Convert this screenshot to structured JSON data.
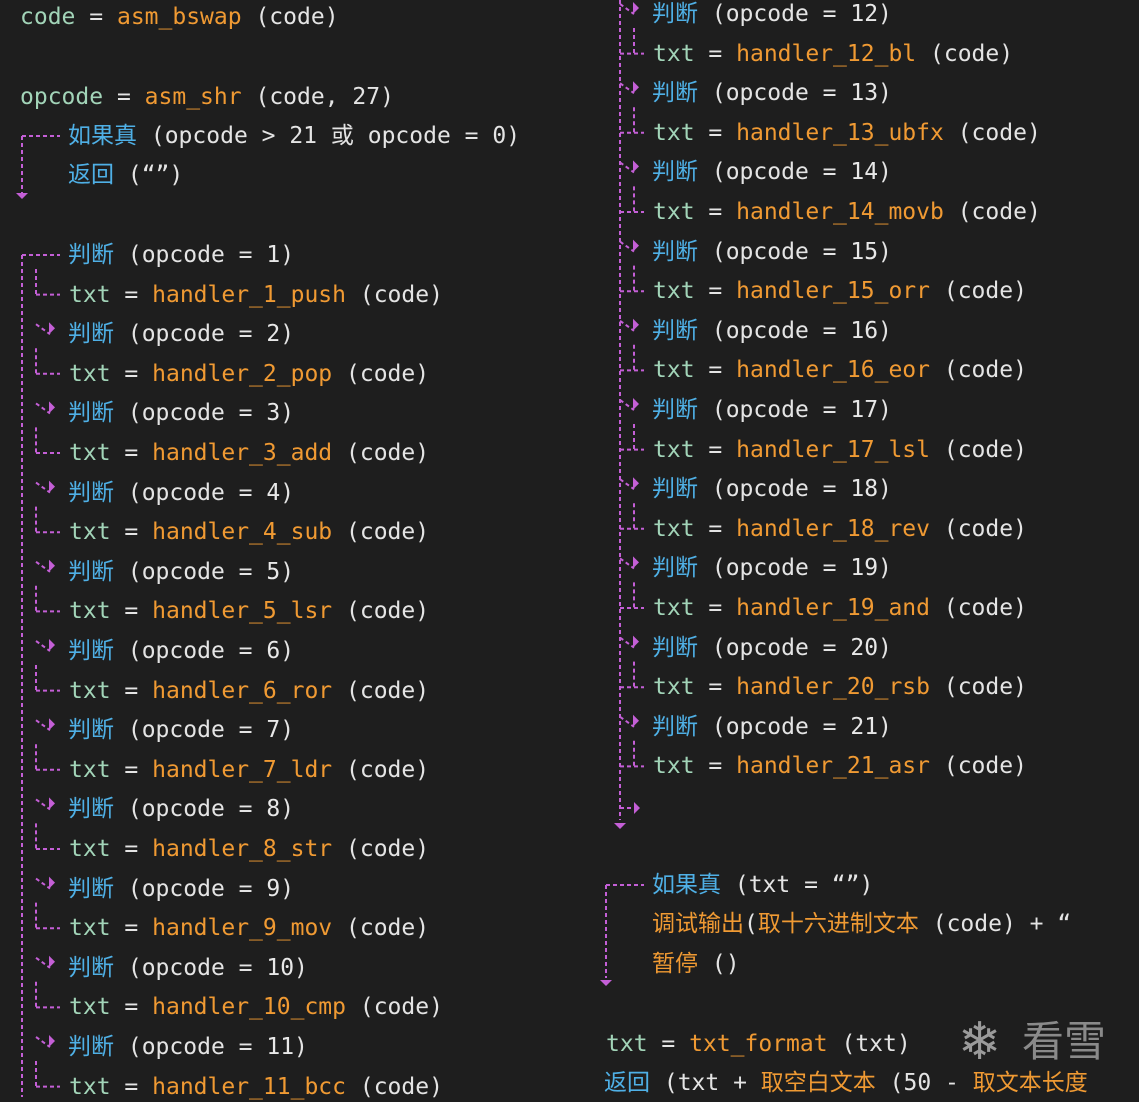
{
  "colors": {
    "background": "#1e1e1e",
    "keyword": "#4fb0e6",
    "variable": "#a2d4b8",
    "function": "#f09a33",
    "flow_line": "#c45fd6"
  },
  "code": {
    "line_code_assign": {
      "var": "code",
      "op": "=",
      "fn": "asm_bswap",
      "args": "(code)"
    },
    "line_opcode_assign": {
      "var": "opcode",
      "op": "=",
      "fn": "asm_shr",
      "args": "(code, 27)"
    },
    "if_true_1": {
      "kw": "如果真",
      "cond": "(opcode > 21 或 opcode = 0)"
    },
    "return_1": {
      "kw": "返回",
      "args": "(“”)"
    },
    "judge_kw": "判断",
    "txt_var": "txt",
    "eq": "=",
    "opcode_prefix": "(opcode = ",
    "paren_close": ")",
    "code_arg": "(code)",
    "cases": [
      {
        "n": "1",
        "handler": "handler_1_push"
      },
      {
        "n": "2",
        "handler": "handler_2_pop"
      },
      {
        "n": "3",
        "handler": "handler_3_add"
      },
      {
        "n": "4",
        "handler": "handler_4_sub"
      },
      {
        "n": "5",
        "handler": "handler_5_lsr"
      },
      {
        "n": "6",
        "handler": "handler_6_ror"
      },
      {
        "n": "7",
        "handler": "handler_7_ldr"
      },
      {
        "n": "8",
        "handler": "handler_8_str"
      },
      {
        "n": "9",
        "handler": "handler_9_mov"
      },
      {
        "n": "10",
        "handler": "handler_10_cmp"
      },
      {
        "n": "11",
        "handler": "handler_11_bcc"
      },
      {
        "n": "12",
        "handler": "handler_12_bl"
      },
      {
        "n": "13",
        "handler": "handler_13_ubfx"
      },
      {
        "n": "14",
        "handler": "handler_14_movb"
      },
      {
        "n": "15",
        "handler": "handler_15_orr"
      },
      {
        "n": "16",
        "handler": "handler_16_eor"
      },
      {
        "n": "17",
        "handler": "handler_17_lsl"
      },
      {
        "n": "18",
        "handler": "handler_18_rev"
      },
      {
        "n": "19",
        "handler": "handler_19_and"
      },
      {
        "n": "20",
        "handler": "handler_20_rsb"
      },
      {
        "n": "21",
        "handler": "handler_21_asr"
      }
    ],
    "if_true_2": {
      "kw": "如果真",
      "cond": "(txt = “”)"
    },
    "debug_out": {
      "fn": "调试输出",
      "args_pre": "(",
      "inner_fn": "取十六进制文本",
      "args_rest": "(code) + “"
    },
    "pause": {
      "fn": "暂停",
      "args": "()"
    },
    "txt_format_line": {
      "var": "txt",
      "op": "=",
      "fn": "txt_format",
      "args": "(txt)"
    },
    "return_2": {
      "kw": "返回",
      "a": "(txt + ",
      "f1": "取空白文本",
      "b": "(50 - ",
      "f2": "取文本长度"
    }
  },
  "watermark": {
    "icon": "snowflake-icon",
    "text": "看雪"
  }
}
